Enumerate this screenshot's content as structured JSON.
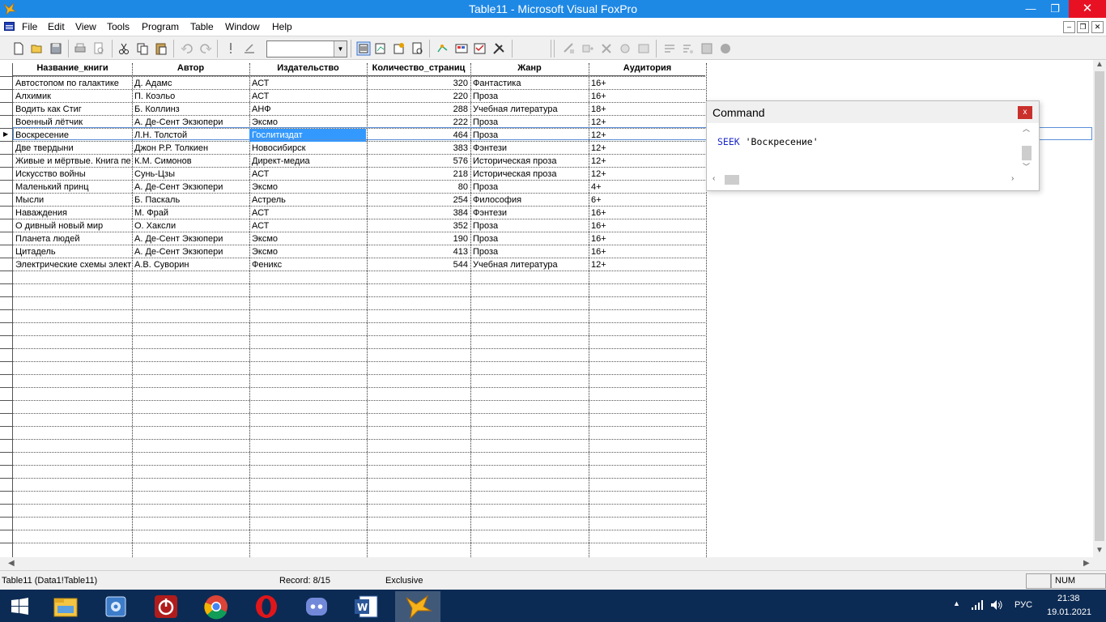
{
  "window": {
    "title": "Table11 - Microsoft Visual FoxPro",
    "min_glyph": "—",
    "max_glyph": "❐",
    "close_glyph": "✕"
  },
  "menu": {
    "items": [
      "File",
      "Edit",
      "View",
      "Tools",
      "Program",
      "Table",
      "Window",
      "Help"
    ]
  },
  "mdi_controls": {
    "min": "–",
    "restore": "❐",
    "close": "✕"
  },
  "toolbar": {
    "icons": [
      "new-file-icon",
      "open-icon",
      "save-icon",
      "print-icon",
      "print-preview-icon",
      "cut-icon",
      "copy-icon",
      "paste-icon",
      "undo-icon",
      "redo-icon",
      "run-icon",
      "modify-form-icon",
      "command-window-icon",
      "database-designer-icon",
      "properties-icon",
      "code-window-icon",
      "form-control-toolbox-icon",
      "color-palette-icon",
      "layout-icon",
      "form-designer-icon",
      "wizard-icon",
      "connections-icon",
      "debugger-icon",
      "align-left-icon",
      "align-center-icon",
      "grid-icon",
      "tab-order-icon",
      "breakpoint-icon"
    ],
    "combo_value": ""
  },
  "grid": {
    "columns": [
      "Название_книги",
      "Автор",
      "Издательство",
      "Количество_страниц",
      "Жанр",
      "Аудитория"
    ],
    "rows": [
      [
        "Автостопом по галактике",
        "Д. Адамс",
        "АСТ",
        "320",
        "Фантастика",
        "16+"
      ],
      [
        "Алхимик",
        "П. Коэльо",
        "АСТ",
        "220",
        "Проза",
        "16+"
      ],
      [
        "Водить как Стиг",
        "Б. Коллинз",
        "АНФ",
        "288",
        "Учебная литература",
        "18+"
      ],
      [
        "Военный лётчик",
        "А. Де-Сент Экзюпери",
        "Эксмо",
        "222",
        "Проза",
        "12+"
      ],
      [
        "Воскресение",
        "Л.Н. Толстой",
        "Гослитиздат",
        "464",
        "Проза",
        "12+"
      ],
      [
        "Две твердыни",
        "Джон Р.Р. Толкиен",
        "Новосибирск",
        "383",
        "Фэнтези",
        "12+"
      ],
      [
        "Живые и мёртвые. Книга первая",
        "К.М. Симонов",
        "Директ-медиа",
        "576",
        "Историческая проза",
        "12+"
      ],
      [
        "Искусство войны",
        "Сунь-Цзы",
        "АСТ",
        "218",
        "Историческая проза",
        "12+"
      ],
      [
        "Маленький принц",
        "А. Де-Сент Экзюпери",
        "Эксмо",
        "80",
        "Проза",
        "4+"
      ],
      [
        "Мысли",
        "Б. Паскаль",
        "Астрель",
        "254",
        "Философия",
        "6+"
      ],
      [
        "Наваждения",
        "М. Фрай",
        "АСТ",
        "384",
        "Фэнтези",
        "16+"
      ],
      [
        "О дивный новый мир",
        "О. Хаксли",
        "АСТ",
        "352",
        "Проза",
        "16+"
      ],
      [
        "Планета людей",
        "А. Де-Сент Экзюпери",
        "Эксмо",
        "190",
        "Проза",
        "16+"
      ],
      [
        "Цитадель",
        "А. Де-Сент Экзюпери",
        "Эксмо",
        "413",
        "Проза",
        "16+"
      ],
      [
        "Электрические схемы электроники",
        "А.В. Суворин",
        "Феникс",
        "544",
        "Учебная литература",
        "12+"
      ]
    ],
    "current_row_index": 4,
    "selected_cell": {
      "row": 4,
      "column": "Издательство"
    }
  },
  "command_window": {
    "title": "Command",
    "keyword": "SEEK",
    "argument": " 'Воскресение'",
    "close_glyph": "x"
  },
  "statusbar": {
    "table": "Table11 (Data1!Table11)",
    "record": "Record: 8/15",
    "mode": "Exclusive",
    "num": "NUM"
  },
  "taskbar": {
    "apps": [
      "start-button",
      "file-explorer",
      "control-panel",
      "shutdown-app",
      "chrome",
      "opera",
      "discord",
      "word",
      "visual-foxpro"
    ],
    "language": "РУС",
    "time": "21:38",
    "date": "19.01.2021"
  },
  "colors": {
    "titlebar": "#1e88e5",
    "selection": "#3399ff",
    "taskbar": "#0c2b54",
    "close_red": "#e81123",
    "command_keyword": "#1a27c9"
  }
}
